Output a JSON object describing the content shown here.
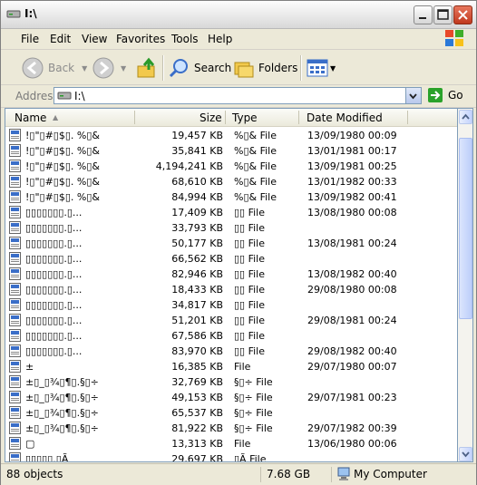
{
  "window": {
    "title": "I:\\"
  },
  "menu": [
    "File",
    "Edit",
    "View",
    "Favorites",
    "Tools",
    "Help"
  ],
  "toolbar": {
    "back_label": "Back",
    "search_label": "Search",
    "folders_label": "Folders"
  },
  "address": {
    "label": "Address",
    "value": "I:\\",
    "go_label": "Go"
  },
  "columns": {
    "name": "Name",
    "size": "Size",
    "type": "Type",
    "date": "Date Modified"
  },
  "rows": [
    {
      "name": "!▯\"▯#▯$▯. %▯&",
      "size": "19,457 KB",
      "type": "%▯& File",
      "date": "13/09/1980 00:09"
    },
    {
      "name": "!▯\"▯#▯$▯. %▯&",
      "size": "35,841 KB",
      "type": "%▯& File",
      "date": "13/01/1981 00:17"
    },
    {
      "name": "!▯\"▯#▯$▯. %▯&",
      "size": "4,194,241 KB",
      "type": "%▯& File",
      "date": "13/09/1981 00:25"
    },
    {
      "name": "!▯\"▯#▯$▯. %▯&",
      "size": "68,610 KB",
      "type": "%▯& File",
      "date": "13/01/1982 00:33"
    },
    {
      "name": "!▯\"▯#▯$▯. %▯&",
      "size": "84,994 KB",
      "type": "%▯& File",
      "date": "13/09/1982 00:41"
    },
    {
      "name": "▯▯▯▯▯▯▯.▯...",
      "size": "17,409 KB",
      "type": "▯▯ File",
      "date": "13/08/1980 00:08"
    },
    {
      "name": "▯▯▯▯▯▯▯.▯...",
      "size": "33,793 KB",
      "type": "▯▯ File",
      "date": ""
    },
    {
      "name": "▯▯▯▯▯▯▯.▯...",
      "size": "50,177 KB",
      "type": "▯▯ File",
      "date": "13/08/1981 00:24"
    },
    {
      "name": "▯▯▯▯▯▯▯.▯...",
      "size": "66,562 KB",
      "type": "▯▯ File",
      "date": ""
    },
    {
      "name": "▯▯▯▯▯▯▯.▯...",
      "size": "82,946 KB",
      "type": "▯▯ File",
      "date": "13/08/1982 00:40"
    },
    {
      "name": "▯▯▯▯▯▯▯.▯...",
      "size": "18,433 KB",
      "type": "▯▯ File",
      "date": "29/08/1980 00:08"
    },
    {
      "name": "▯▯▯▯▯▯▯.▯...",
      "size": "34,817 KB",
      "type": "▯▯ File",
      "date": ""
    },
    {
      "name": "▯▯▯▯▯▯▯.▯...",
      "size": "51,201 KB",
      "type": "▯▯ File",
      "date": "29/08/1981 00:24"
    },
    {
      "name": "▯▯▯▯▯▯▯.▯...",
      "size": "67,586 KB",
      "type": "▯▯ File",
      "date": ""
    },
    {
      "name": "▯▯▯▯▯▯▯.▯...",
      "size": "83,970 KB",
      "type": "▯▯ File",
      "date": "29/08/1982 00:40"
    },
    {
      "name": "±",
      "size": "16,385 KB",
      "type": "File",
      "date": "29/07/1980 00:07"
    },
    {
      "name": "±▯_▯¾▯¶▯.§▯÷",
      "size": "32,769 KB",
      "type": "§▯÷ File",
      "date": ""
    },
    {
      "name": "±▯_▯¾▯¶▯.§▯÷",
      "size": "49,153 KB",
      "type": "§▯÷ File",
      "date": "29/07/1981 00:23"
    },
    {
      "name": "±▯_▯¾▯¶▯.§▯÷",
      "size": "65,537 KB",
      "type": "§▯÷ File",
      "date": ""
    },
    {
      "name": "±▯_▯¾▯¶▯.§▯÷",
      "size": "81,922 KB",
      "type": "§▯÷ File",
      "date": "29/07/1982 00:39"
    },
    {
      "name": "▢",
      "size": "13,313 KB",
      "type": "File",
      "date": "13/06/1980 00:06"
    },
    {
      "name": "▯▯▯▯▯.▯Ã",
      "size": "29,697 KB",
      "type": "▯Ã File",
      "date": ""
    }
  ],
  "status": {
    "objects": "88 objects",
    "size": "7.68 GB",
    "location": "My Computer"
  }
}
